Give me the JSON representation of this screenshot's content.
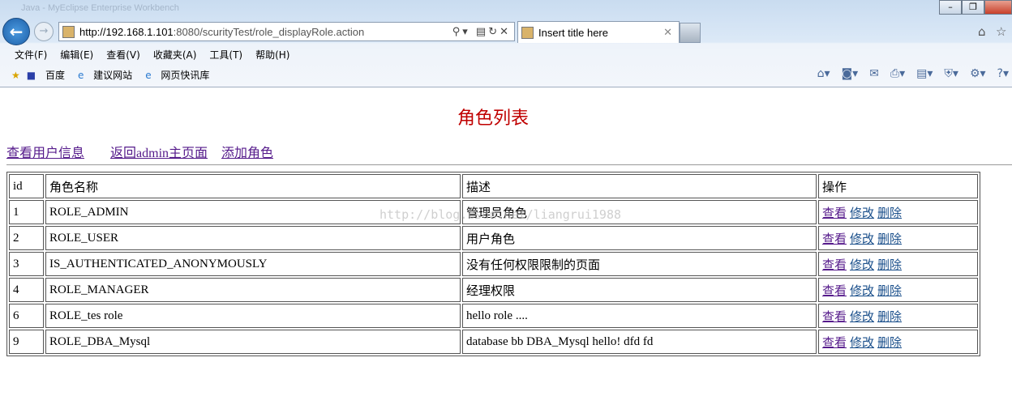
{
  "browser": {
    "window_title": "Java - MyEclipse Enterprise Workbench",
    "url_host": "http://192.168.1.101",
    "url_path": ":8080/scurityTest/role_displayRole.action",
    "tab_title": "Insert title here",
    "menu": [
      "文件(F)",
      "编辑(E)",
      "查看(V)",
      "收藏夹(A)",
      "工具(T)",
      "帮助(H)"
    ],
    "favorites": [
      "百度",
      "建议网站",
      "网页快讯库"
    ]
  },
  "page": {
    "title": "角色列表",
    "links": [
      "查看用户信息",
      "返回admin主页面",
      "添加角色"
    ],
    "watermark": "http://blog.csdn.net/liangrui1988",
    "headers": [
      "id",
      "角色名称",
      "描述",
      "操作"
    ],
    "actions": [
      "查看",
      "修改",
      "删除"
    ],
    "rows": [
      {
        "id": "1",
        "name": "ROLE_ADMIN",
        "desc": "管理员角色"
      },
      {
        "id": "2",
        "name": "ROLE_USER",
        "desc": "用户角色"
      },
      {
        "id": "3",
        "name": "IS_AUTHENTICATED_ANONYMOUSLY",
        "desc": "没有任何权限限制的页面"
      },
      {
        "id": "4",
        "name": "ROLE_MANAGER",
        "desc": "经理权限"
      },
      {
        "id": "6",
        "name": "ROLE_tes role",
        "desc": "hello role ...."
      },
      {
        "id": "9",
        "name": "ROLE_DBA_Mysql",
        "desc": "database bb DBA_Mysql hello! dfd fd"
      }
    ]
  }
}
